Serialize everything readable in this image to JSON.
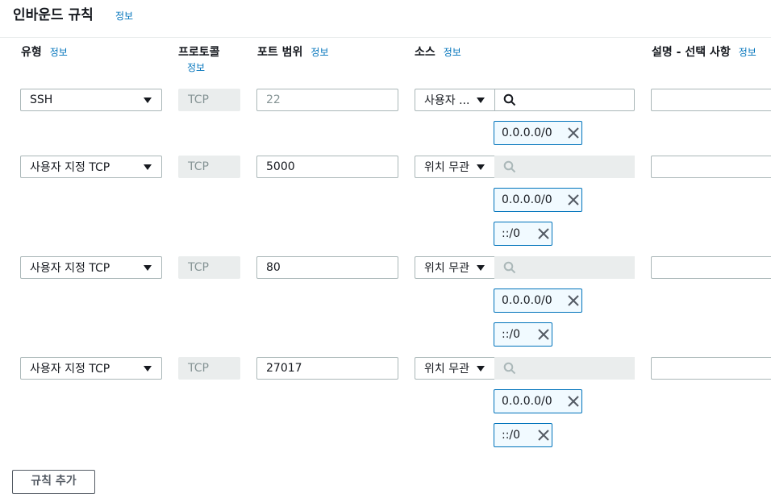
{
  "section": {
    "title": "인바운드 규칙",
    "info": "정보"
  },
  "headers": {
    "type": "유형",
    "protocol": "프로토콜",
    "port_range": "포트 범위",
    "source": "소스",
    "description": "설명 - 선택 사항",
    "info": "정보"
  },
  "rules": [
    {
      "type": "SSH",
      "protocol": "TCP",
      "port": "22",
      "source_type": "사용자 ...",
      "tokens": [
        "0.0.0.0/0"
      ]
    },
    {
      "type": "사용자 지정 TCP",
      "protocol": "TCP",
      "port": "5000",
      "source_type": "위치 무관",
      "tokens": [
        "0.0.0.0/0",
        "::/0"
      ]
    },
    {
      "type": "사용자 지정 TCP",
      "protocol": "TCP",
      "port": "80",
      "source_type": "위치 무관",
      "tokens": [
        "0.0.0.0/0",
        "::/0"
      ]
    },
    {
      "type": "사용자 지정 TCP",
      "protocol": "TCP",
      "port": "27017",
      "source_type": "위치 무관",
      "tokens": [
        "0.0.0.0/0",
        "::/0"
      ]
    }
  ],
  "add_rule_button": "규칙 추가",
  "colors": {
    "link": "#0073bb",
    "token_bg": "#f1faff",
    "disabled_bg": "#eaeded"
  },
  "icons": {
    "search": "search-icon",
    "remove": "close-icon",
    "dropdown": "caret-down-icon"
  }
}
